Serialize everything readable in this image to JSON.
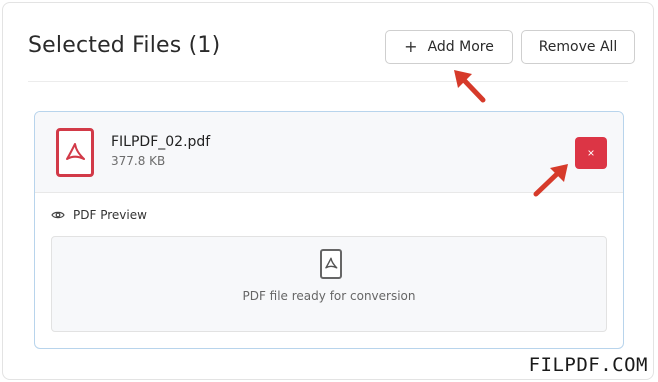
{
  "header": {
    "title": "Selected Files (1)",
    "add_more_label": "Add More",
    "remove_all_label": "Remove All"
  },
  "file": {
    "name": "FILPDF_02.pdf",
    "size": "377.8 KB",
    "remove_glyph": "×",
    "icon": "pdf-file-icon"
  },
  "preview": {
    "label": "PDF Preview",
    "status_text": "PDF file ready for conversion",
    "label_icon": "eye-icon"
  },
  "annotations": {
    "arrow_color": "#d63a2a"
  },
  "watermark": "FILPDF.COM",
  "colors": {
    "danger": "#dc3545",
    "pdf_red": "#d23a48",
    "card_border": "#b8d4ec"
  }
}
